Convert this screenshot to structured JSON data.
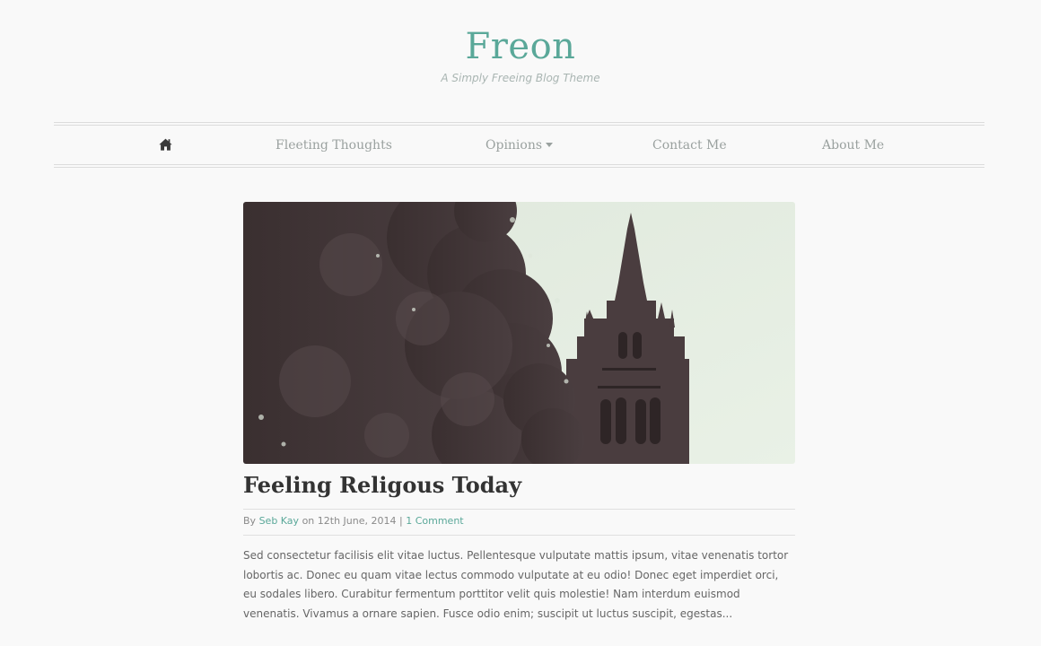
{
  "header": {
    "title": "Freon",
    "tagline": "A Simply Freeing Blog Theme"
  },
  "nav": {
    "home_icon": "home-icon",
    "items": [
      {
        "label": "Fleeting Thoughts"
      },
      {
        "label": "Opinions",
        "has_dropdown": true,
        "dropdown_icon": "caret-down-icon"
      },
      {
        "label": "Contact Me"
      },
      {
        "label": "About Me"
      }
    ]
  },
  "post": {
    "image_description": "church-spire-and-tree-photo",
    "title": "Feeling Religous Today",
    "meta": {
      "by_label": "By",
      "author": "Seb Kay",
      "on_label": "on",
      "date": "12th June, 2014",
      "separator": "|",
      "comments": "1 Comment"
    },
    "excerpt": "Sed consectetur facilisis elit vitae luctus. Pellentesque vulputate mattis ipsum, vitae venenatis tortor lobortis ac. Donec eu quam vitae lectus commodo vulputate at eu odio! Donec eget imperdiet orci, eu sodales libero. Curabitur fermentum porttitor velit quis molestie! Nam interdum euismod venenatis. Vivamus a ornare sapien. Fusce odio enim; suscipit ut luctus suscipit, egestas..."
  },
  "colors": {
    "accent": "#5aa899",
    "background": "#f9f9f9",
    "nav_text": "#9aa19f",
    "tagline": "#a9b5b2"
  }
}
